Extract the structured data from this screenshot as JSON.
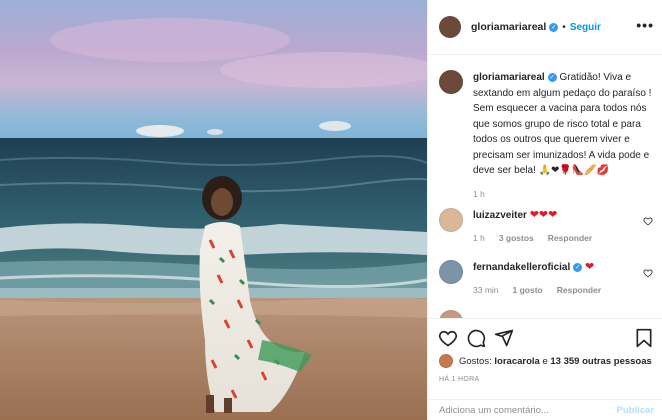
{
  "post": {
    "username": "gloriamariareal",
    "follow_label": "Seguir",
    "more_label": "•••"
  },
  "caption": {
    "username": "gloriamariareal",
    "text": "Gratidão! Viva e sextando em algum pedaço do paraíso ! Sem esquecer a vacina para todos nós que somos grupo de risco total e para todos os outros que querem viver e precisam ser imunizados! A vida pode e deve ser bela! 🙏❤🌹👠🥖💋",
    "time": "1 h"
  },
  "comments": [
    {
      "username": "luizazveiter",
      "text": "❤❤❤",
      "time": "1 h",
      "likes": "3 gostos",
      "reply": "Responder"
    },
    {
      "username": "fernandakelleroficial",
      "text": "❤",
      "time": "33 min",
      "likes": "1 gosto",
      "reply": "Responder"
    }
  ],
  "likes": {
    "prefix": "Gostos:",
    "first_user": "loracarola",
    "joiner": "e",
    "others": "13 359 outras pessoas"
  },
  "timestamp": "HÁ 1 HORA",
  "add_comment": {
    "placeholder": "Adiciona um comentário...",
    "publish_label": "Publicar"
  },
  "icons": {
    "like": "heart-icon",
    "comment": "comment-icon",
    "share": "send-icon",
    "save": "bookmark-icon"
  },
  "colors": {
    "accent": "#0095f6",
    "verified": "#3897f0",
    "heart": "#e0192b",
    "muted": "#8e8e8e"
  }
}
